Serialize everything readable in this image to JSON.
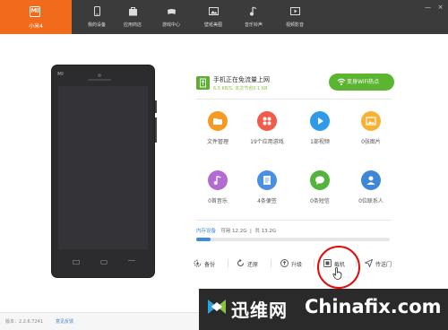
{
  "brand": {
    "label": "小米4",
    "logo_text": "MI"
  },
  "nav_tabs": [
    {
      "label": "我的设备",
      "icon": "phone-icon"
    },
    {
      "label": "应用商店",
      "icon": "bag-icon"
    },
    {
      "label": "游戏中心",
      "icon": "gamepad-icon"
    },
    {
      "label": "壁纸美图",
      "icon": "picture-icon"
    },
    {
      "label": "音乐铃声",
      "icon": "music-icon"
    },
    {
      "label": "视频影音",
      "icon": "video-icon"
    }
  ],
  "window_controls": {
    "minimize": "—",
    "close": "×"
  },
  "phone": {
    "logo": "MI"
  },
  "status": {
    "title": "手机正在免流量上网",
    "subtitle": "6.5 KB/S, 本次节省0.1 KB"
  },
  "wifi_button": {
    "label": "变身WiFi热点"
  },
  "tiles": [
    {
      "label": "文件管理",
      "color": "#f59a23",
      "icon": "folder-icon"
    },
    {
      "label": "19个应用游戏",
      "color": "#f25a4a",
      "icon": "apps-icon"
    },
    {
      "label": "1部视频",
      "color": "#2f9be8",
      "icon": "play-icon"
    },
    {
      "label": "0张图片",
      "color": "#f7b233",
      "icon": "picture-icon"
    },
    {
      "label": "0首音乐",
      "color": "#b36ad1",
      "icon": "music-icon"
    },
    {
      "label": "4条便签",
      "color": "#4a90e2",
      "icon": "note-icon"
    },
    {
      "label": "0条短信",
      "color": "#52b43c",
      "icon": "chat-icon"
    },
    {
      "label": "0位联系人",
      "color": "#3d87d6",
      "icon": "contact-icon"
    }
  ],
  "storage": {
    "label": "内存设备",
    "available": "可用 12.2G",
    "total": "共 13.2G",
    "used_fraction": 0.075
  },
  "actions": [
    {
      "label": "备份",
      "icon": "backup-icon"
    },
    {
      "label": "还原",
      "icon": "restore-icon"
    },
    {
      "label": "升级",
      "icon": "upgrade-icon"
    },
    {
      "label": "截机",
      "icon": "screenshot-icon"
    },
    {
      "label": "传送门",
      "icon": "send-icon"
    }
  ],
  "footer": {
    "version": "版本：2.2.6.7241",
    "feedback": "意见反馈"
  },
  "watermark": {
    "cn": "迅维网",
    "en": "Chinafix.com"
  }
}
